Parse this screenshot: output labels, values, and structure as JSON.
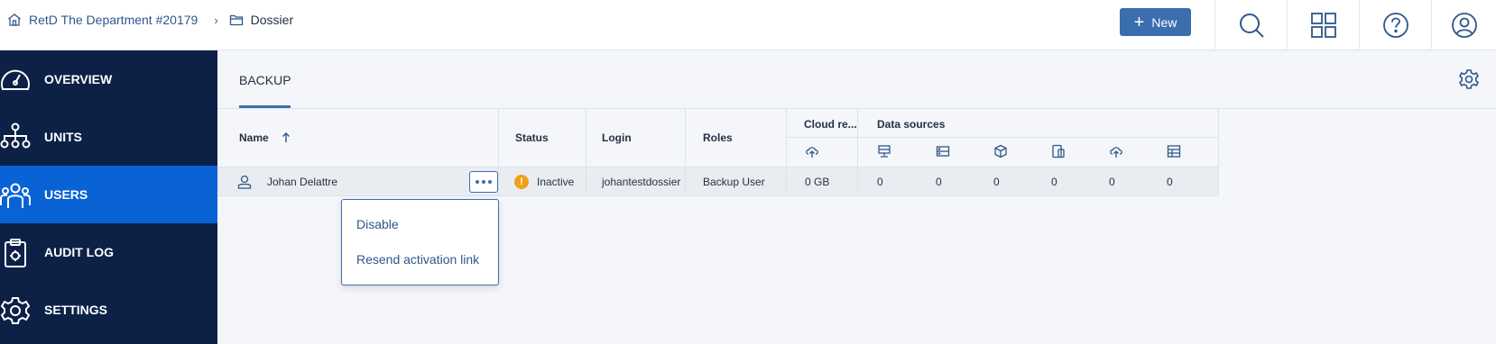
{
  "breadcrumb": {
    "items": [
      {
        "label": "RetD The Department #20179",
        "icon": "building-icon"
      },
      {
        "label": "Dossier",
        "icon": "folder-icon"
      }
    ]
  },
  "header": {
    "new_button": "New",
    "icons": [
      "search-icon",
      "apps-grid-icon",
      "help-icon",
      "user-account-icon"
    ]
  },
  "sidebar": {
    "items": [
      {
        "label": "OVERVIEW",
        "icon": "dashboard-icon",
        "active": false
      },
      {
        "label": "UNITS",
        "icon": "hierarchy-icon",
        "active": false
      },
      {
        "label": "USERS",
        "icon": "users-icon",
        "active": true
      },
      {
        "label": "AUDIT LOG",
        "icon": "audit-log-icon",
        "active": false
      },
      {
        "label": "SETTINGS",
        "icon": "settings-icon",
        "active": false
      }
    ]
  },
  "main": {
    "tab": "BACKUP",
    "table": {
      "columns": {
        "name": "Name",
        "status": "Status",
        "login": "Login",
        "roles": "Roles",
        "cloud": "Cloud re...",
        "data_sources": "Data sources"
      },
      "data_source_icons": [
        "workstation-icon",
        "server-icon",
        "virtual-machine-icon",
        "mobile-device-icon",
        "cloud-upload-icon",
        "table-icon"
      ],
      "rows": [
        {
          "name": "Johan Delattre",
          "status": "Inactive",
          "login": "johantestdossier",
          "roles": "Backup User",
          "cloud": "0 GB",
          "sources": [
            "0",
            "0",
            "0",
            "0",
            "0",
            "0"
          ]
        }
      ]
    },
    "menu": {
      "items": [
        "Disable",
        "Resend activation link"
      ]
    }
  },
  "colors": {
    "sidebar": "#0d2147",
    "active": "#0a63d5",
    "accent": "#3a6eaf",
    "warning": "#f0a019"
  }
}
